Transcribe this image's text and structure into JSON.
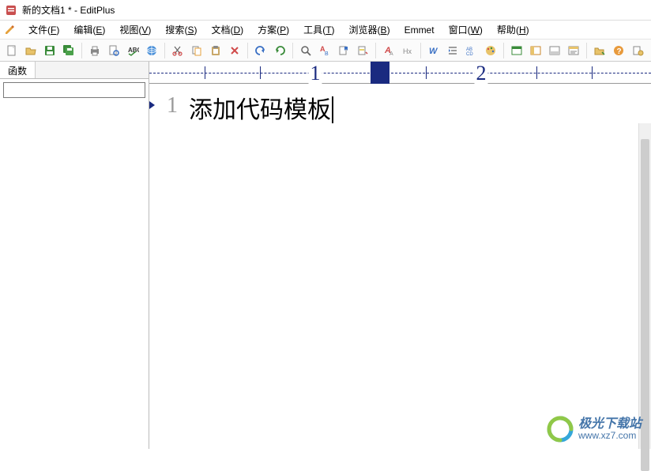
{
  "title": "新的文档1 * - EditPlus",
  "menu": {
    "items": [
      {
        "label": "文件",
        "key": "F"
      },
      {
        "label": "编辑",
        "key": "E"
      },
      {
        "label": "视图",
        "key": "V"
      },
      {
        "label": "搜索",
        "key": "S"
      },
      {
        "label": "文档",
        "key": "D"
      },
      {
        "label": "方案",
        "key": "P"
      },
      {
        "label": "工具",
        "key": "T"
      },
      {
        "label": "浏览器",
        "key": "B"
      },
      {
        "label": "Emmet",
        "key": ""
      },
      {
        "label": "窗口",
        "key": "W"
      },
      {
        "label": "帮助",
        "key": "H"
      }
    ]
  },
  "toolbar_icons": [
    "new-file",
    "open",
    "save",
    "save-all",
    "sep",
    "print",
    "print-preview",
    "spell",
    "open-browser",
    "sep",
    "cut",
    "copy",
    "paste",
    "delete",
    "sep",
    "undo",
    "redo",
    "sep",
    "find",
    "find-replace",
    "bookmark",
    "highlight",
    "sep",
    "font-color",
    "hex",
    "sep",
    "wordwrap",
    "indent",
    "autocomplete",
    "palette",
    "sep",
    "window",
    "cliptext",
    "directory",
    "output",
    "sep",
    "folder-toggle",
    "help",
    "options"
  ],
  "sidebar": {
    "tab_label": "函数",
    "input_value": ""
  },
  "ruler": {
    "marks": [
      "1",
      "2"
    ]
  },
  "editor": {
    "line_number": "1",
    "content": "添加代码模板"
  },
  "watermark": {
    "name": "极光下载站",
    "url": "www.xz7.com"
  }
}
